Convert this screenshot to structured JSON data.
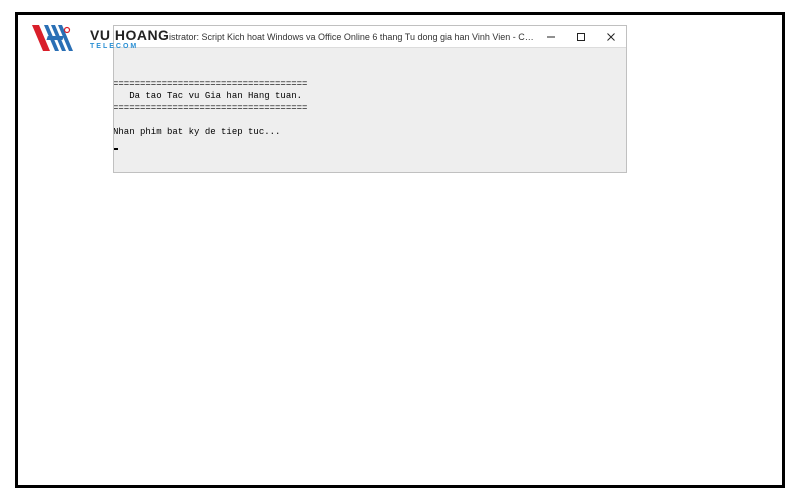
{
  "logo": {
    "main_text": "VU HOANG",
    "sub_text": "TELECOM",
    "red_color": "#d91f2a",
    "blue_color": "#2a6fb5"
  },
  "window": {
    "title": "istrator:  Script Kich hoat Windows va Office Online 6 thang Tu dong gia han Vinh Vien - Copy...",
    "minimize_label": "Minimize",
    "maximize_label": "Maximize",
    "close_label": "Close"
  },
  "console": {
    "separator": "====================================",
    "message_line": "   Da tao Tac vu Gia han Hang tuan.",
    "prompt_line": "Nhan phim bat ky de tiep tuc..."
  }
}
